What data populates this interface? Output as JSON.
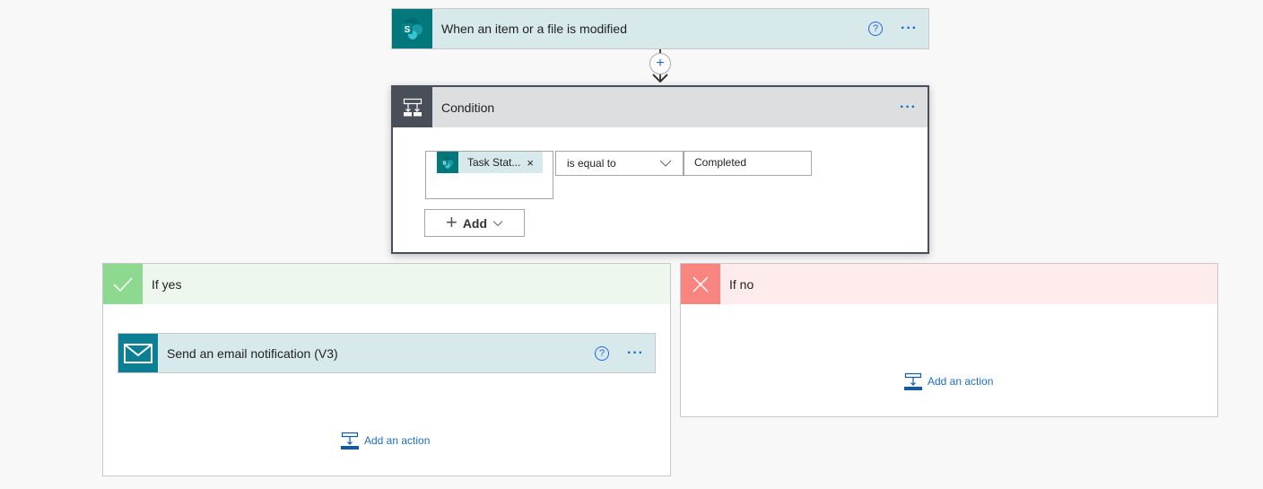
{
  "trigger": {
    "title": "When an item or a file is modified",
    "icon": "sharepoint-icon",
    "help_symbol": "?",
    "more_symbol": "···",
    "color": "#03787c"
  },
  "connector": {
    "insert_symbol": "+"
  },
  "condition": {
    "title": "Condition",
    "icon": "condition-icon",
    "more_symbol": "···",
    "row": {
      "token_label": "Task Stat...",
      "token_remove_symbol": "×",
      "operator": "is equal to",
      "value": "Completed"
    },
    "add_label": "Add",
    "add_plus_symbol": "+"
  },
  "branches": {
    "yes": {
      "title": "If yes",
      "color": "#8cd98f",
      "actions": [
        {
          "title": "Send an email notification (V3)",
          "icon": "mail-icon",
          "help_symbol": "?",
          "more_symbol": "···"
        }
      ],
      "add_action_label": "Add an action"
    },
    "no": {
      "title": "If no",
      "color": "#f8857f",
      "add_action_label": "Add an action"
    }
  }
}
